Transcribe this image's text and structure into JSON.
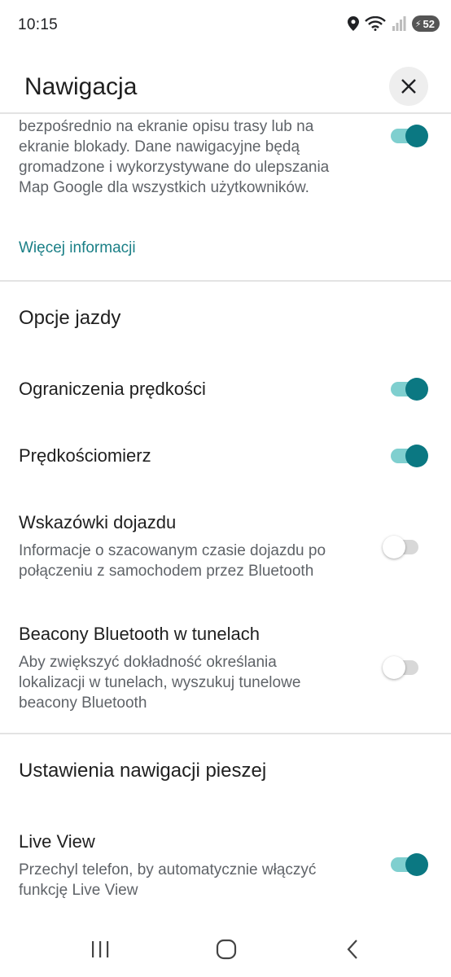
{
  "status_bar": {
    "time": "10:15",
    "battery": "52",
    "icons": [
      "location-icon",
      "wifi-icon",
      "signal-icon",
      "battery-icon"
    ]
  },
  "header": {
    "title": "Nawigacja",
    "close_icon": "close-icon"
  },
  "top_description": {
    "lines": [
      "bezpośrednio na ekranie opisu trasy lub na",
      "ekranie blokady. Dane nawigacyjne będą",
      "gromadzone i wykorzystywane do ulepszania",
      "Map Google dla wszystkich użytkowników."
    ],
    "toggle_on": true,
    "link": "Więcej informacji"
  },
  "driving_section": {
    "title": "Opcje jazdy",
    "items": [
      {
        "title": "Ograniczenia prędkości",
        "description": [],
        "toggle_on": true
      },
      {
        "title": "Prędkościomierz",
        "description": [],
        "toggle_on": true
      },
      {
        "title": "Wskazówki dojazdu",
        "description": [
          "Informacje o szacowanym czasie dojazdu po",
          "połączeniu z samochodem przez Bluetooth"
        ],
        "toggle_on": false
      },
      {
        "title": "Beacony Bluetooth w tunelach",
        "description": [
          "Aby zwiększyć dokładność określania",
          "lokalizacji w tunelach, wyszukuj tunelowe",
          "beacony Bluetooth"
        ],
        "toggle_on": false
      }
    ]
  },
  "walking_section": {
    "title": "Ustawienia nawigacji pieszej",
    "items": [
      {
        "title": "Live View",
        "description": [
          "Przechyl telefon, by automatycznie włączyć",
          "funkcję Live View"
        ],
        "toggle_on": true
      }
    ]
  },
  "colors": {
    "accent": "#0b7882",
    "accent_track": "#7fcfcf",
    "link": "#1a7f86",
    "secondary_text": "#5f6368"
  },
  "nav_bar": {
    "buttons": [
      "recents-icon",
      "home-icon",
      "back-icon"
    ]
  }
}
